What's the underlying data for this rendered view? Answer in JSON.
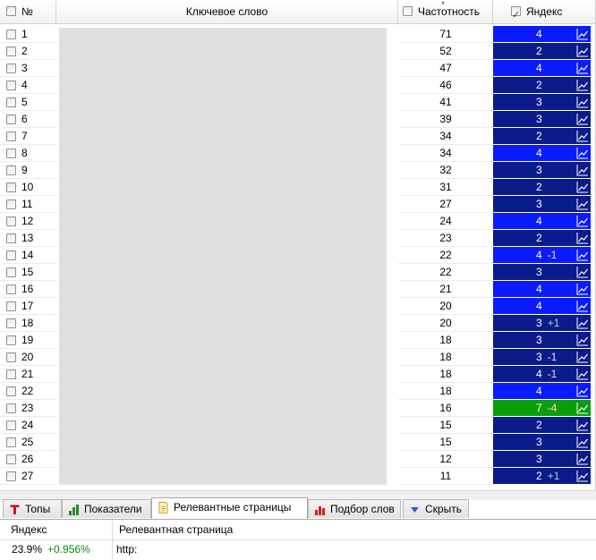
{
  "columns": {
    "num": "№",
    "keyword": "Ключевое слово",
    "frequency": "Частотность",
    "yandex": "Яндекс"
  },
  "header_checks": {
    "num": false,
    "frequency": false,
    "yandex": true
  },
  "colors": {
    "dark_blue": "#0a1b8c",
    "bright_blue": "#0b1bff",
    "green": "#0a9e0a"
  },
  "rows": [
    {
      "n": "1",
      "freq": "71",
      "pos": "4",
      "change": "",
      "color": "bright_blue"
    },
    {
      "n": "2",
      "freq": "52",
      "pos": "2",
      "change": "",
      "color": "dark_blue"
    },
    {
      "n": "3",
      "freq": "47",
      "pos": "4",
      "change": "",
      "color": "bright_blue"
    },
    {
      "n": "4",
      "freq": "46",
      "pos": "2",
      "change": "",
      "color": "dark_blue"
    },
    {
      "n": "5",
      "freq": "41",
      "pos": "3",
      "change": "",
      "color": "dark_blue"
    },
    {
      "n": "6",
      "freq": "39",
      "pos": "3",
      "change": "",
      "color": "dark_blue"
    },
    {
      "n": "7",
      "freq": "34",
      "pos": "2",
      "change": "",
      "color": "dark_blue"
    },
    {
      "n": "8",
      "freq": "34",
      "pos": "4",
      "change": "",
      "color": "bright_blue"
    },
    {
      "n": "9",
      "freq": "32",
      "pos": "3",
      "change": "",
      "color": "dark_blue"
    },
    {
      "n": "10",
      "freq": "31",
      "pos": "2",
      "change": "",
      "color": "dark_blue"
    },
    {
      "n": "11",
      "freq": "27",
      "pos": "3",
      "change": "",
      "color": "dark_blue"
    },
    {
      "n": "12",
      "freq": "24",
      "pos": "4",
      "change": "",
      "color": "bright_blue"
    },
    {
      "n": "13",
      "freq": "23",
      "pos": "2",
      "change": "",
      "color": "dark_blue"
    },
    {
      "n": "14",
      "freq": "22",
      "pos": "4",
      "change": "-1",
      "color": "bright_blue"
    },
    {
      "n": "15",
      "freq": "22",
      "pos": "3",
      "change": "",
      "color": "dark_blue"
    },
    {
      "n": "16",
      "freq": "21",
      "pos": "4",
      "change": "",
      "color": "bright_blue"
    },
    {
      "n": "17",
      "freq": "20",
      "pos": "4",
      "change": "",
      "color": "bright_blue"
    },
    {
      "n": "18",
      "freq": "20",
      "pos": "3",
      "change": "+1",
      "color": "dark_blue"
    },
    {
      "n": "19",
      "freq": "18",
      "pos": "3",
      "change": "",
      "color": "dark_blue"
    },
    {
      "n": "20",
      "freq": "18",
      "pos": "3",
      "change": "-1",
      "color": "dark_blue"
    },
    {
      "n": "21",
      "freq": "18",
      "pos": "4",
      "change": "-1",
      "color": "dark_blue"
    },
    {
      "n": "22",
      "freq": "18",
      "pos": "4",
      "change": "",
      "color": "bright_blue"
    },
    {
      "n": "23",
      "freq": "16",
      "pos": "7",
      "change": "-4",
      "color": "green"
    },
    {
      "n": "24",
      "freq": "15",
      "pos": "2",
      "change": "",
      "color": "dark_blue"
    },
    {
      "n": "25",
      "freq": "15",
      "pos": "3",
      "change": "",
      "color": "dark_blue"
    },
    {
      "n": "26",
      "freq": "12",
      "pos": "3",
      "change": "",
      "color": "dark_blue"
    },
    {
      "n": "27",
      "freq": "11",
      "pos": "2",
      "change": "+1",
      "color": "dark_blue"
    }
  ],
  "tabs": [
    {
      "label": "Топы",
      "icon": "letter-t-icon",
      "active": false
    },
    {
      "label": "Показатели",
      "icon": "bar-chart-icon",
      "active": false
    },
    {
      "label": "Релевантные страницы",
      "icon": "document-icon",
      "active": true
    },
    {
      "label": "Подбор слов",
      "icon": "red-bar-chart-icon",
      "active": false
    },
    {
      "label": "Скрыть",
      "icon": "triangle-down-icon",
      "active": false
    }
  ],
  "relevant": {
    "col_engine": "Яндекс",
    "col_page": "Релевантная страница",
    "percent": "23.9%",
    "delta": "+0.956%",
    "url": "http:"
  }
}
